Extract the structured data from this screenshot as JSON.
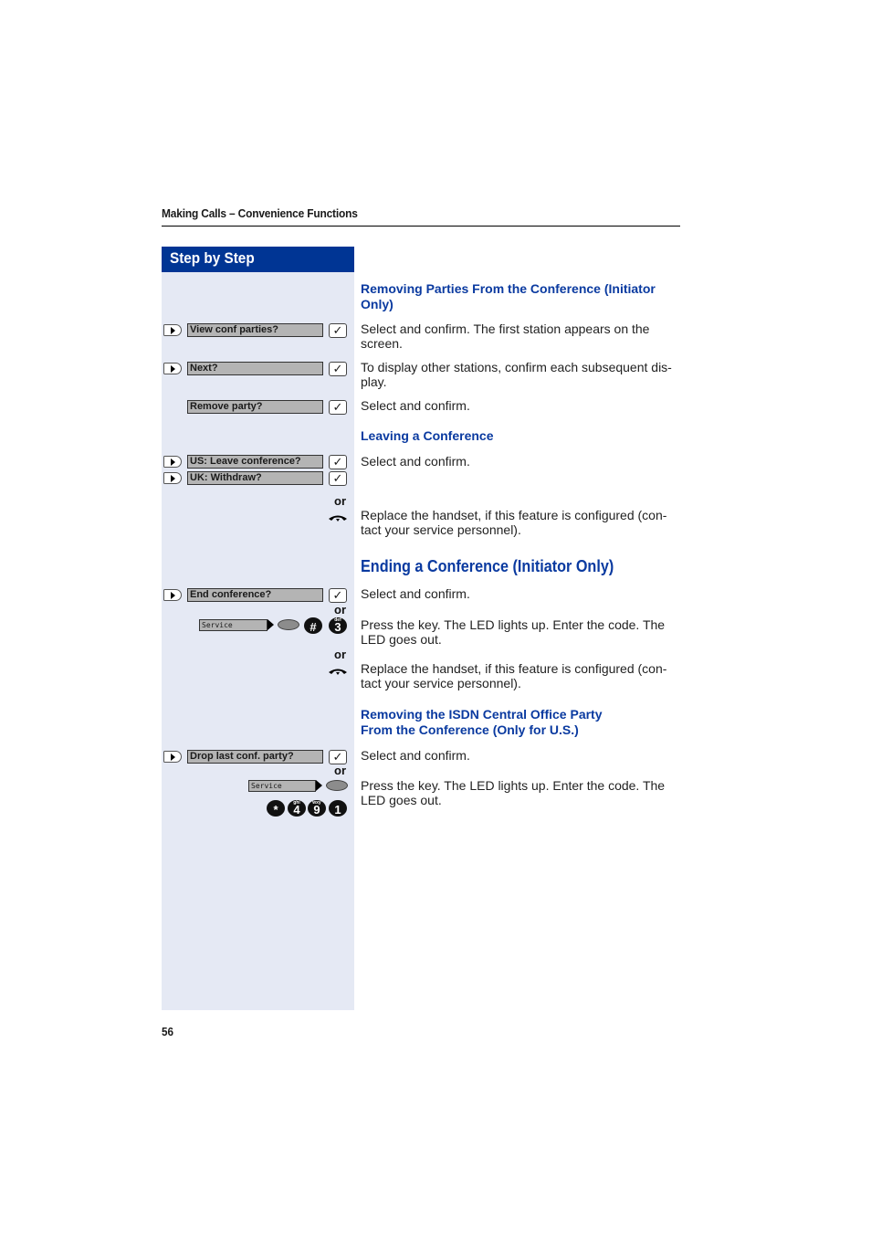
{
  "header": {
    "running_title": "Making Calls – Convenience Functions"
  },
  "step_by_step": {
    "title": "Step by Step"
  },
  "sections": [
    {
      "heading": "Removing Parties From the Conference (Initiator Only)",
      "steps": [
        {
          "display": "View conf parties?",
          "text": "Select and confirm. The first station appears on the screen."
        },
        {
          "display": "Next?",
          "text": "To display other stations, confirm each subsequent display."
        },
        {
          "display": "Remove party?",
          "text": "Select and confirm."
        }
      ]
    },
    {
      "heading": "Leaving a Conference",
      "steps": [
        {
          "display": "US: Leave conference?",
          "text": "Select and confirm."
        },
        {
          "display": "UK: Withdraw?"
        },
        {
          "or": "or",
          "text": "Replace the handset, if this feature is configured (contact your service personnel)."
        }
      ]
    },
    {
      "heading": "Ending a Conference (Initiator Only)",
      "steps": [
        {
          "display": "End conference?",
          "text": "Select and confirm."
        },
        {
          "or": "or",
          "service_key": "Service",
          "keys": [
            "#",
            "3"
          ],
          "key_subs": [
            "",
            "def"
          ],
          "text": "Press the key. The LED lights up. Enter the code. The LED goes out."
        },
        {
          "or": "or",
          "text": "Replace the handset, if this feature is configured (contact your service personnel)."
        }
      ]
    },
    {
      "heading_line1": "Removing the ISDN Central Office Party",
      "heading_line2": "From the Conference (Only for U.S.)",
      "steps": [
        {
          "display": "Drop last conf. party?",
          "text": "Select and confirm."
        },
        {
          "or": "or",
          "service_key": "Service",
          "text": "Press the key. The LED lights up. Enter the code. The LED goes out."
        },
        {
          "keys": [
            "*",
            "4",
            "9",
            "1"
          ],
          "key_subs": [
            "",
            "ghi",
            "wxy",
            ""
          ]
        }
      ]
    }
  ],
  "texts_hyphenated": {
    "s1_t1_l1": "Select and confirm. The first station appears on the",
    "s1_t1_l2": "screen.",
    "s1_t2_l1": "To display other stations, confirm each subsequent dis-",
    "s1_t2_l2": "play.",
    "replace_l1": "Replace the handset, if this feature is configured (con-",
    "replace_l2": "tact your service personnel).",
    "press_l1": "Press the key. The LED lights up. Enter the code. The",
    "press_l2": "LED goes out.",
    "h1_l1": "Removing Parties From the Conference (Initiator",
    "h1_l2": "Only)"
  },
  "icons": {
    "check": "✓"
  },
  "footer": {
    "page_number": "56"
  }
}
